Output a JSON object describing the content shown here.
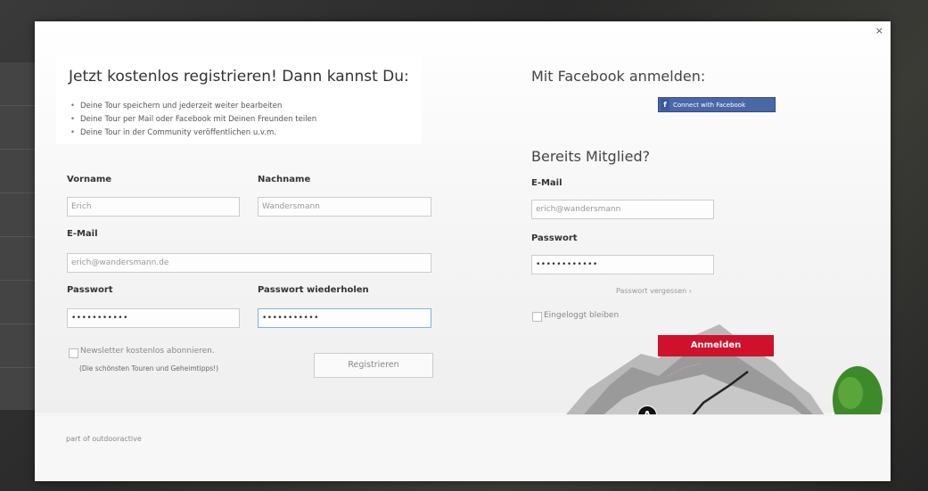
{
  "modal": {
    "close_label": "×",
    "footer_text": "part of outdooractive"
  },
  "register": {
    "title": "Jetzt kostenlos registrieren! Dann kannst Du:",
    "bullets": [
      "Deine Tour speichern und jederzeit weiter bearbeiten",
      "Deine Tour per Mail oder Facebook mit Deinen Freunden teilen",
      "Deine Tour in der Community veröffentlichen u.v.m."
    ],
    "firstname_label": "Vorname",
    "firstname_placeholder": "Erich",
    "lastname_label": "Nachname",
    "lastname_placeholder": "Wandersmann",
    "email_label": "E-Mail",
    "email_placeholder": "erich@wandersmann.de",
    "password_label": "Passwort",
    "password_value": "•••••••••••",
    "password_repeat_label": "Passwort wiederholen",
    "password_repeat_value": "•••••••••••",
    "newsletter_label": "Newsletter kostenlos abonnieren.",
    "newsletter_note": "(Die schönsten Touren und Geheimtipps!)",
    "register_button": "Registrieren"
  },
  "facebook": {
    "title": "Mit Facebook anmelden:",
    "button": "Connect with Facebook",
    "icon": "f"
  },
  "login": {
    "title": "Bereits Mitglied?",
    "email_label": "E-Mail",
    "email_placeholder": "erich@wandersmann",
    "password_label": "Passwort",
    "password_value": "••••••••••••",
    "forgot_link": "Passwort vergessen ›",
    "stay_logged_in": "Eingeloggt bleiben",
    "login_button": "Anmelden"
  },
  "map_marker": "A",
  "colors": {
    "login_button": "#d0112b",
    "facebook_button": "#4a67a8"
  }
}
